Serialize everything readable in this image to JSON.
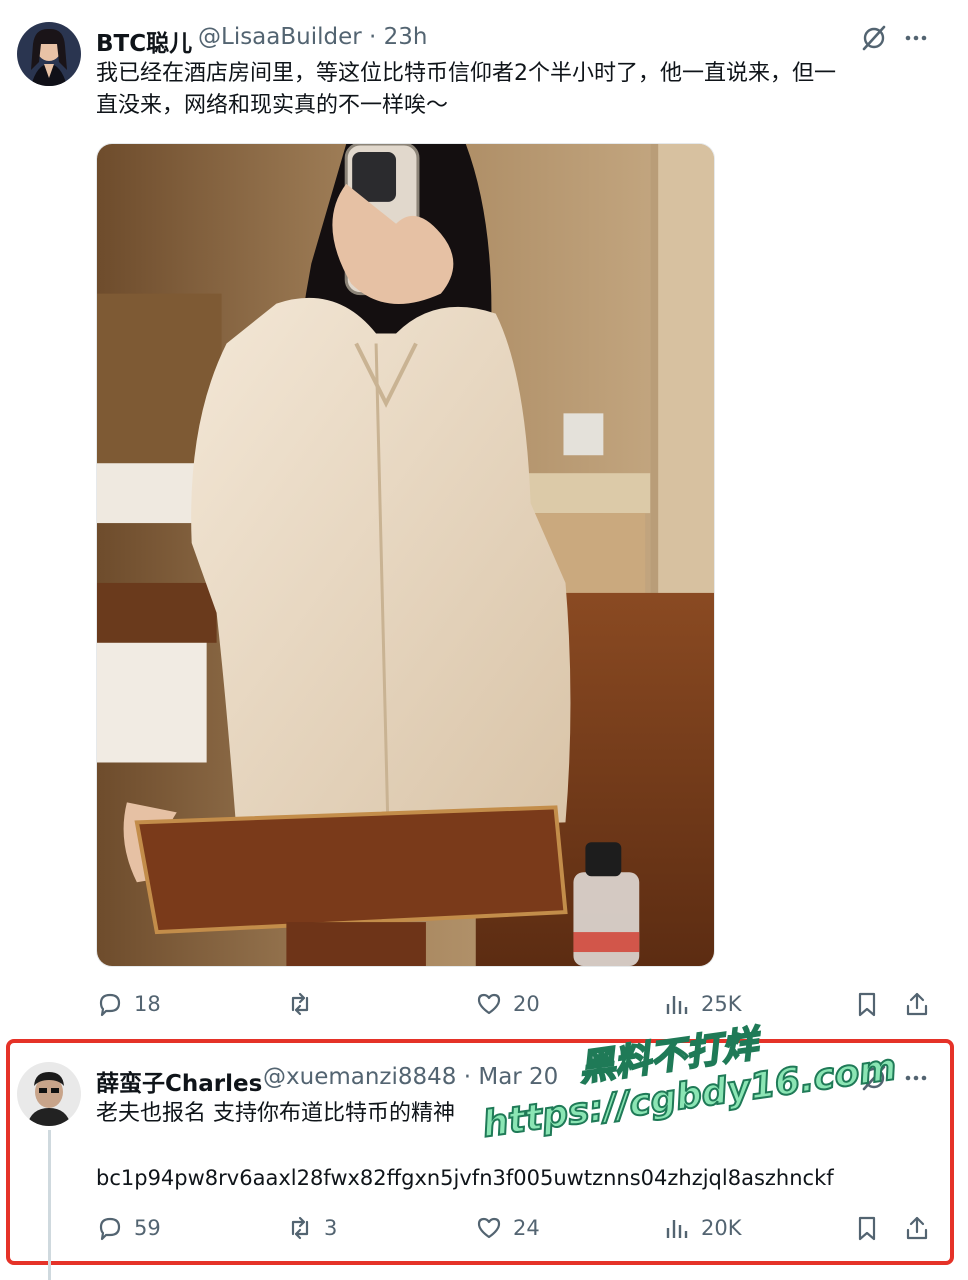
{
  "post": {
    "author_name": "BTC聪儿",
    "handle_time": "@LisaaBuilder · 23h",
    "text_line1": "我已经在酒店房间里，等这位比特币信仰者2个半小时了，他一直说来，但一",
    "text_line2": "直没来，网络和现实真的不一样唉～",
    "stats": {
      "replies": "18",
      "reposts": "",
      "likes": "20",
      "views": "25K"
    }
  },
  "reply": {
    "author_name": "薛蛮子Charles",
    "handle_time": "@xuemanzi8848 · Mar 20",
    "text_line1": "老夫也报名  支持你布道比特币的精神",
    "text_line2": "bc1p94pw8rv6aaxl28fwx82ffgxn5jvfn3f005uwtznns04zhzjql8aszhnckf",
    "stats": {
      "replies": "59",
      "reposts": "3",
      "likes": "24",
      "views": "20K"
    }
  },
  "watermark": {
    "line1": "黑料不打烊",
    "line2": "https://cgbdy16.com"
  },
  "colors": {
    "text_primary": "#0f1419",
    "text_secondary": "#536471",
    "highlight_border": "#e53228",
    "watermark_fill": "#8be5b4"
  },
  "icons": [
    "grok-icon",
    "more-icon",
    "reply-icon",
    "repost-icon",
    "like-icon",
    "views-icon",
    "bookmark-icon",
    "share-icon"
  ]
}
